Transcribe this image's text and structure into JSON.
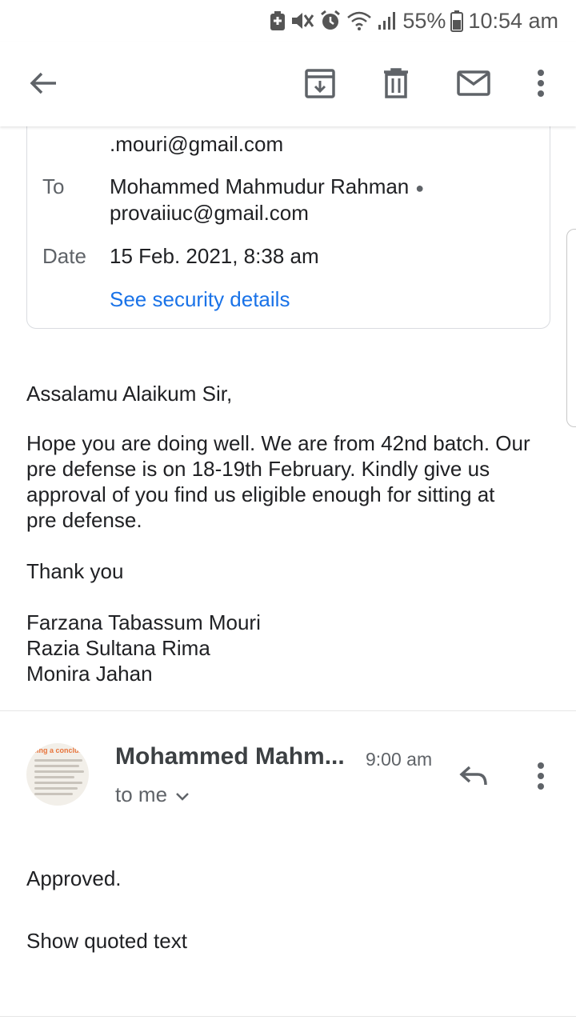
{
  "status_bar": {
    "battery_percent": "55%",
    "time": "10:54 am",
    "icons": [
      "battery-saver-icon",
      "mute-icon",
      "alarm-icon",
      "wifi-icon",
      "signal-icon",
      "battery-icon"
    ]
  },
  "app_bar": {
    "icons": [
      "back-arrow-icon",
      "archive-icon",
      "delete-icon",
      "mark-unread-icon",
      "more-vert-icon"
    ]
  },
  "details": {
    "from_tail": ".mouri@gmail.com",
    "to_label": "To",
    "to_name": "Mohammed Mahmudur Rahman",
    "to_email": "provaiiuc@gmail.com",
    "date_label": "Date",
    "date_value": "15 Feb. 2021, 8:38 am",
    "security_link": "See security details"
  },
  "message1": {
    "greeting": "Assalamu Alaikum Sir,",
    "para_lines": [
      "Hope you are doing well. We are from 42nd batch. Our",
      "pre defense is on 18-19th February. Kindly give us",
      "approval of you find us eligible enough for sitting at",
      "pre defense."
    ],
    "thanks": "Thank you",
    "signatures": [
      "Farzana Tabassum Mouri",
      "Razia Sultana Rima",
      "Monira Jahan"
    ]
  },
  "message2": {
    "sender": "Mohammed Mahm...",
    "time": "9:00 am",
    "recipient": "to me",
    "avatar_text": "sing a conclusi",
    "body": "Approved.",
    "quoted_link": "Show quoted text"
  },
  "colors": {
    "link": "#1a73e8",
    "label": "#5f6368",
    "text": "#202124",
    "icon": "#5f6368"
  }
}
